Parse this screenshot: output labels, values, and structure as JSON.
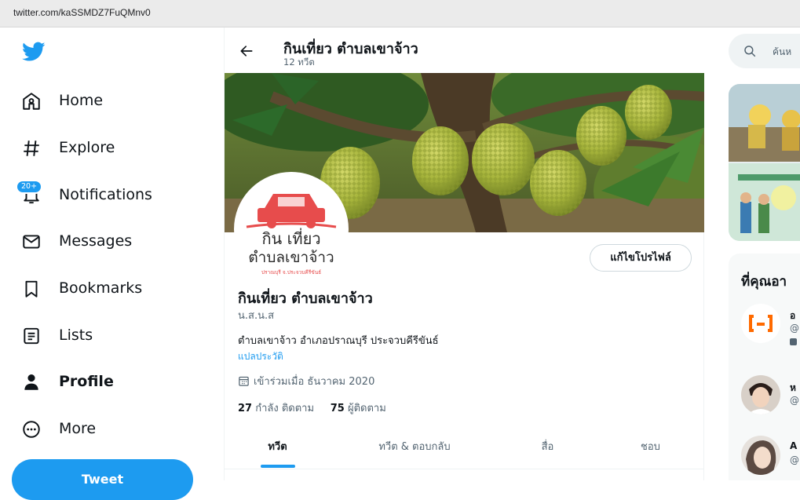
{
  "browser": {
    "url": "twitter.com/kaSSMDZ7FuQMnv0"
  },
  "nav": {
    "items": [
      {
        "label": "Home",
        "icon": "home-icon"
      },
      {
        "label": "Explore",
        "icon": "hashtag-icon"
      },
      {
        "label": "Notifications",
        "icon": "bell-icon",
        "badge": "20+"
      },
      {
        "label": "Messages",
        "icon": "envelope-icon"
      },
      {
        "label": "Bookmarks",
        "icon": "bookmark-icon"
      },
      {
        "label": "Lists",
        "icon": "list-icon"
      },
      {
        "label": "Profile",
        "icon": "person-icon"
      },
      {
        "label": "More",
        "icon": "more-circle-icon"
      }
    ],
    "tweet_button": "Tweet"
  },
  "header": {
    "title": "กินเที่ยว ตำบลเขาจ้าว",
    "tweet_count": "12 ทวีต"
  },
  "avatar_text": {
    "line1": "กิน เที่ยว",
    "line2": "ตำบลเขาจ้าว",
    "line3": "ปราณบุรี จ.ประจวบคีรีขันธ์"
  },
  "profile": {
    "edit_button": "แก้ไขโปรไฟล์",
    "name": "กินเที่ยว ตำบลเขาจ้าว",
    "handle": "น.ส.น.ส",
    "bio": "ตำบลเขาจ้าว อำเภอปราณบุรี ประจวบคีรีขันธ์",
    "translate": "แปลประวัติ",
    "joined": "เข้าร่วมเมื่อ ธันวาคม 2020",
    "following_count": "27",
    "following_label": "กำลัง ติดตาม",
    "followers_count": "75",
    "followers_label": "ผู้ติดตาม"
  },
  "tabs": [
    "ทวีต",
    "ทวีต & ตอบกลับ",
    "สื่อ",
    "ชอบ"
  ],
  "right": {
    "search_placeholder": "ค้นห",
    "who_to_follow": "ที่คุณอา",
    "suggestions": [
      {
        "name": "อ",
        "handle": "@"
      },
      {
        "name": "ห",
        "handle": "@"
      },
      {
        "name": "A",
        "handle": "@"
      }
    ]
  },
  "colors": {
    "accent": "#1d9bf0",
    "text": "#0f1419",
    "muted": "#536471"
  }
}
